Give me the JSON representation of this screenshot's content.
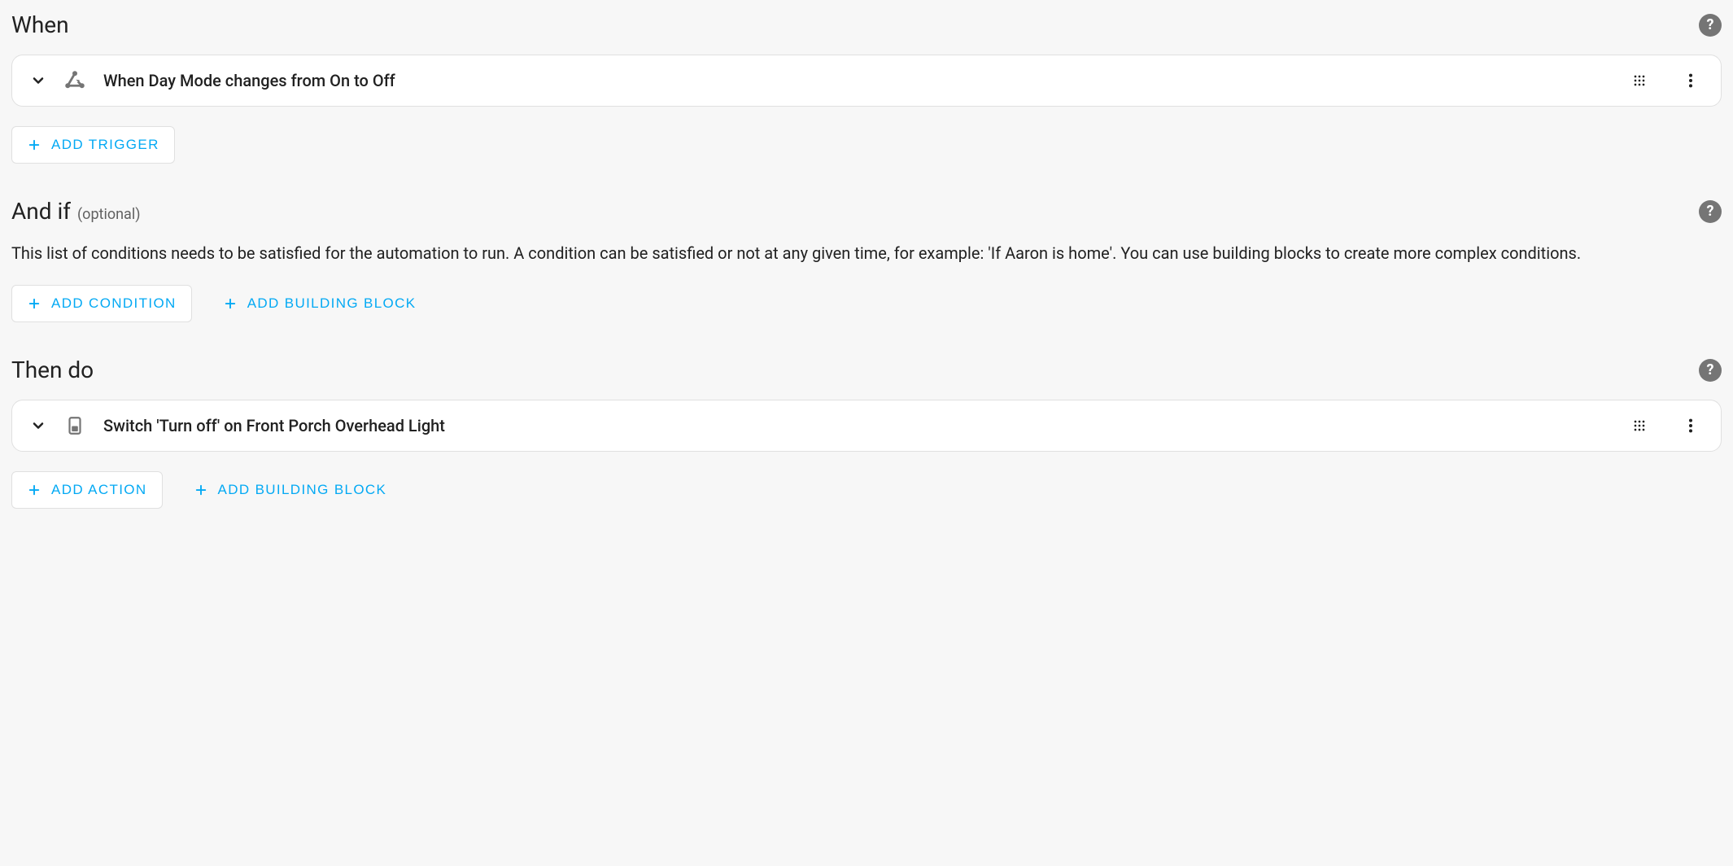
{
  "sections": {
    "when": {
      "title": "When",
      "entry_label": "When Day Mode changes from On to Off",
      "add_trigger_label": "Add Trigger"
    },
    "andif": {
      "title": "And if",
      "optional_label": "(optional)",
      "description": "This list of conditions needs to be satisfied for the automation to run. A condition can be satisfied or not at any given time, for example: 'If Aaron is home'. You can use building blocks to create more complex conditions.",
      "add_condition_label": "Add Condition",
      "add_building_block_label": "Add Building Block"
    },
    "thendo": {
      "title": "Then do",
      "entry_label": "Switch 'Turn off' on Front Porch Overhead Light",
      "add_action_label": "Add Action",
      "add_building_block_label": "Add Building Block"
    }
  }
}
